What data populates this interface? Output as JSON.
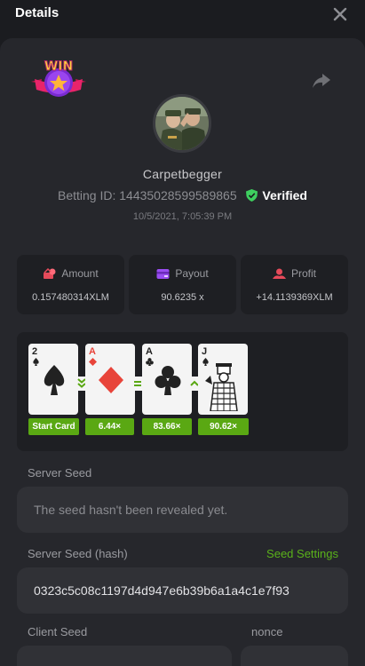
{
  "header": {
    "title": "Details"
  },
  "player": {
    "username": "Carpetbegger",
    "betting_id_label": "Betting ID:",
    "betting_id": "14435028599589865",
    "verified": "Verified",
    "date": "10/5/2021, 7:05:39 PM"
  },
  "badge": {
    "text": "WIN"
  },
  "stats": {
    "amount": {
      "label": "Amount",
      "value": "0.157480314XLM"
    },
    "payout": {
      "label": "Payout",
      "value": "90.6235 x"
    },
    "profit": {
      "label": "Profit",
      "value": "+14.1139369XLM"
    }
  },
  "cards": [
    {
      "rank": "2",
      "suit": "spade",
      "color": "#222222",
      "tag": "Start Card"
    },
    {
      "rank": "A",
      "suit": "diamond",
      "color": "#e8443a",
      "tag": "6.44×",
      "op": "lower"
    },
    {
      "rank": "A",
      "suit": "club",
      "color": "#222222",
      "tag": "83.66×",
      "op": "equal"
    },
    {
      "rank": "J",
      "suit": "spade",
      "color": "#222222",
      "tag": "90.62×",
      "op": "higher"
    }
  ],
  "server_seed": {
    "label": "Server Seed",
    "value": "The seed hasn't been revealed yet."
  },
  "server_seed_hash": {
    "label": "Server Seed (hash)",
    "value": "0323c5c08c1197d4d947e6b39b6a1a4c1e7f93",
    "link": "Seed Settings"
  },
  "client_seed": {
    "label": "Client Seed"
  },
  "nonce": {
    "label": "nonce"
  },
  "colors": {
    "accent": "#5aa813",
    "link": "#5ab21a",
    "verified_shield": "#3ecf5f"
  }
}
